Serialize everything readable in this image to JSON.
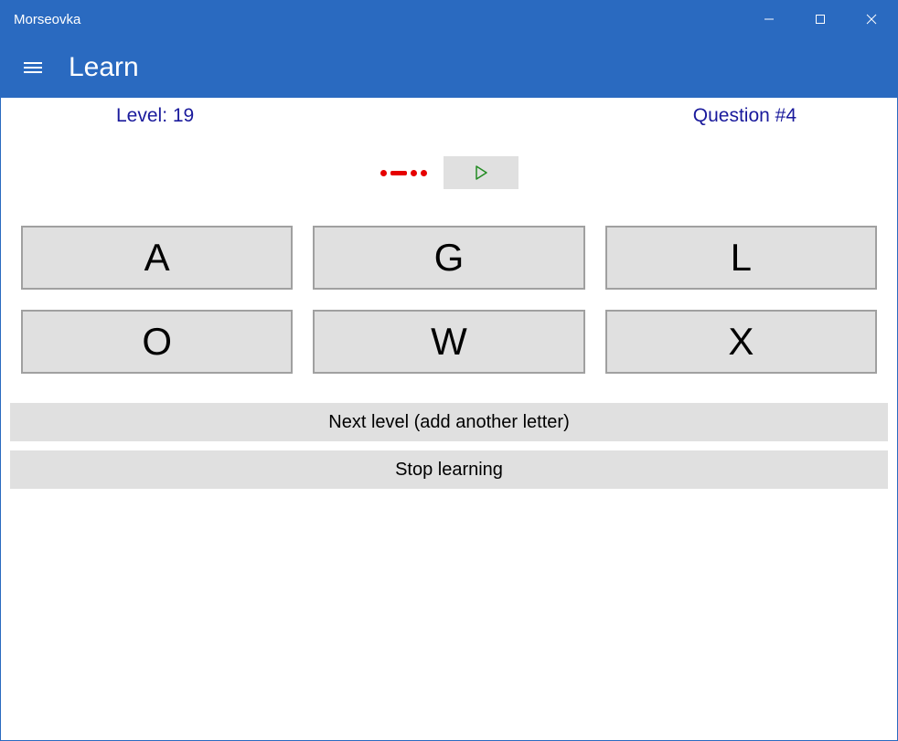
{
  "window": {
    "title": "Morseovka"
  },
  "header": {
    "page_title": "Learn"
  },
  "status": {
    "level_label": "Level: 19",
    "question_label": "Question #4"
  },
  "morse": {
    "pattern": ".-.."
  },
  "letters": [
    "A",
    "G",
    "L",
    "O",
    "W",
    "X"
  ],
  "actions": {
    "next_level": "Next level (add another letter)",
    "stop_learning": "Stop learning"
  }
}
